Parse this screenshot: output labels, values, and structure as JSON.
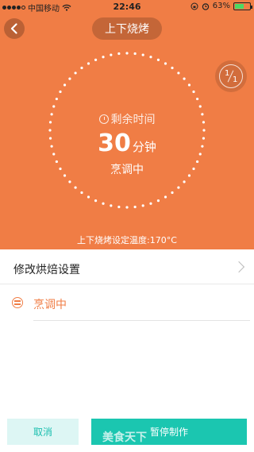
{
  "status_bar": {
    "carrier": "中国移动",
    "time": "22:46",
    "battery_percent": "63%",
    "battery_level": 0.63,
    "signal_bars_filled": 4,
    "icons": [
      "wifi-icon",
      "rotation-lock-icon",
      "alarm-icon",
      "battery-icon"
    ]
  },
  "nav": {
    "title": "上下烧烤",
    "back_icon": "chevron-left-icon"
  },
  "page_indicator": {
    "current": "1",
    "total": "1"
  },
  "timer": {
    "label": "剩余时间",
    "value": "30",
    "unit": "分钟",
    "status": "烹调中"
  },
  "temperature_line": "上下烧烤设定温度:170°C",
  "settings_row": {
    "label": "修改烘焙设置"
  },
  "status_row": {
    "label": "烹调中"
  },
  "buttons": {
    "cancel": "取消",
    "pause": "暂停制作"
  },
  "watermark": "美食天下",
  "colors": {
    "hero": "#F07D45",
    "accent": "#F07D45",
    "primary_button": "#1BC6B0",
    "secondary_button_bg": "#DDF6F4",
    "secondary_button_text": "#1BBFAF"
  }
}
